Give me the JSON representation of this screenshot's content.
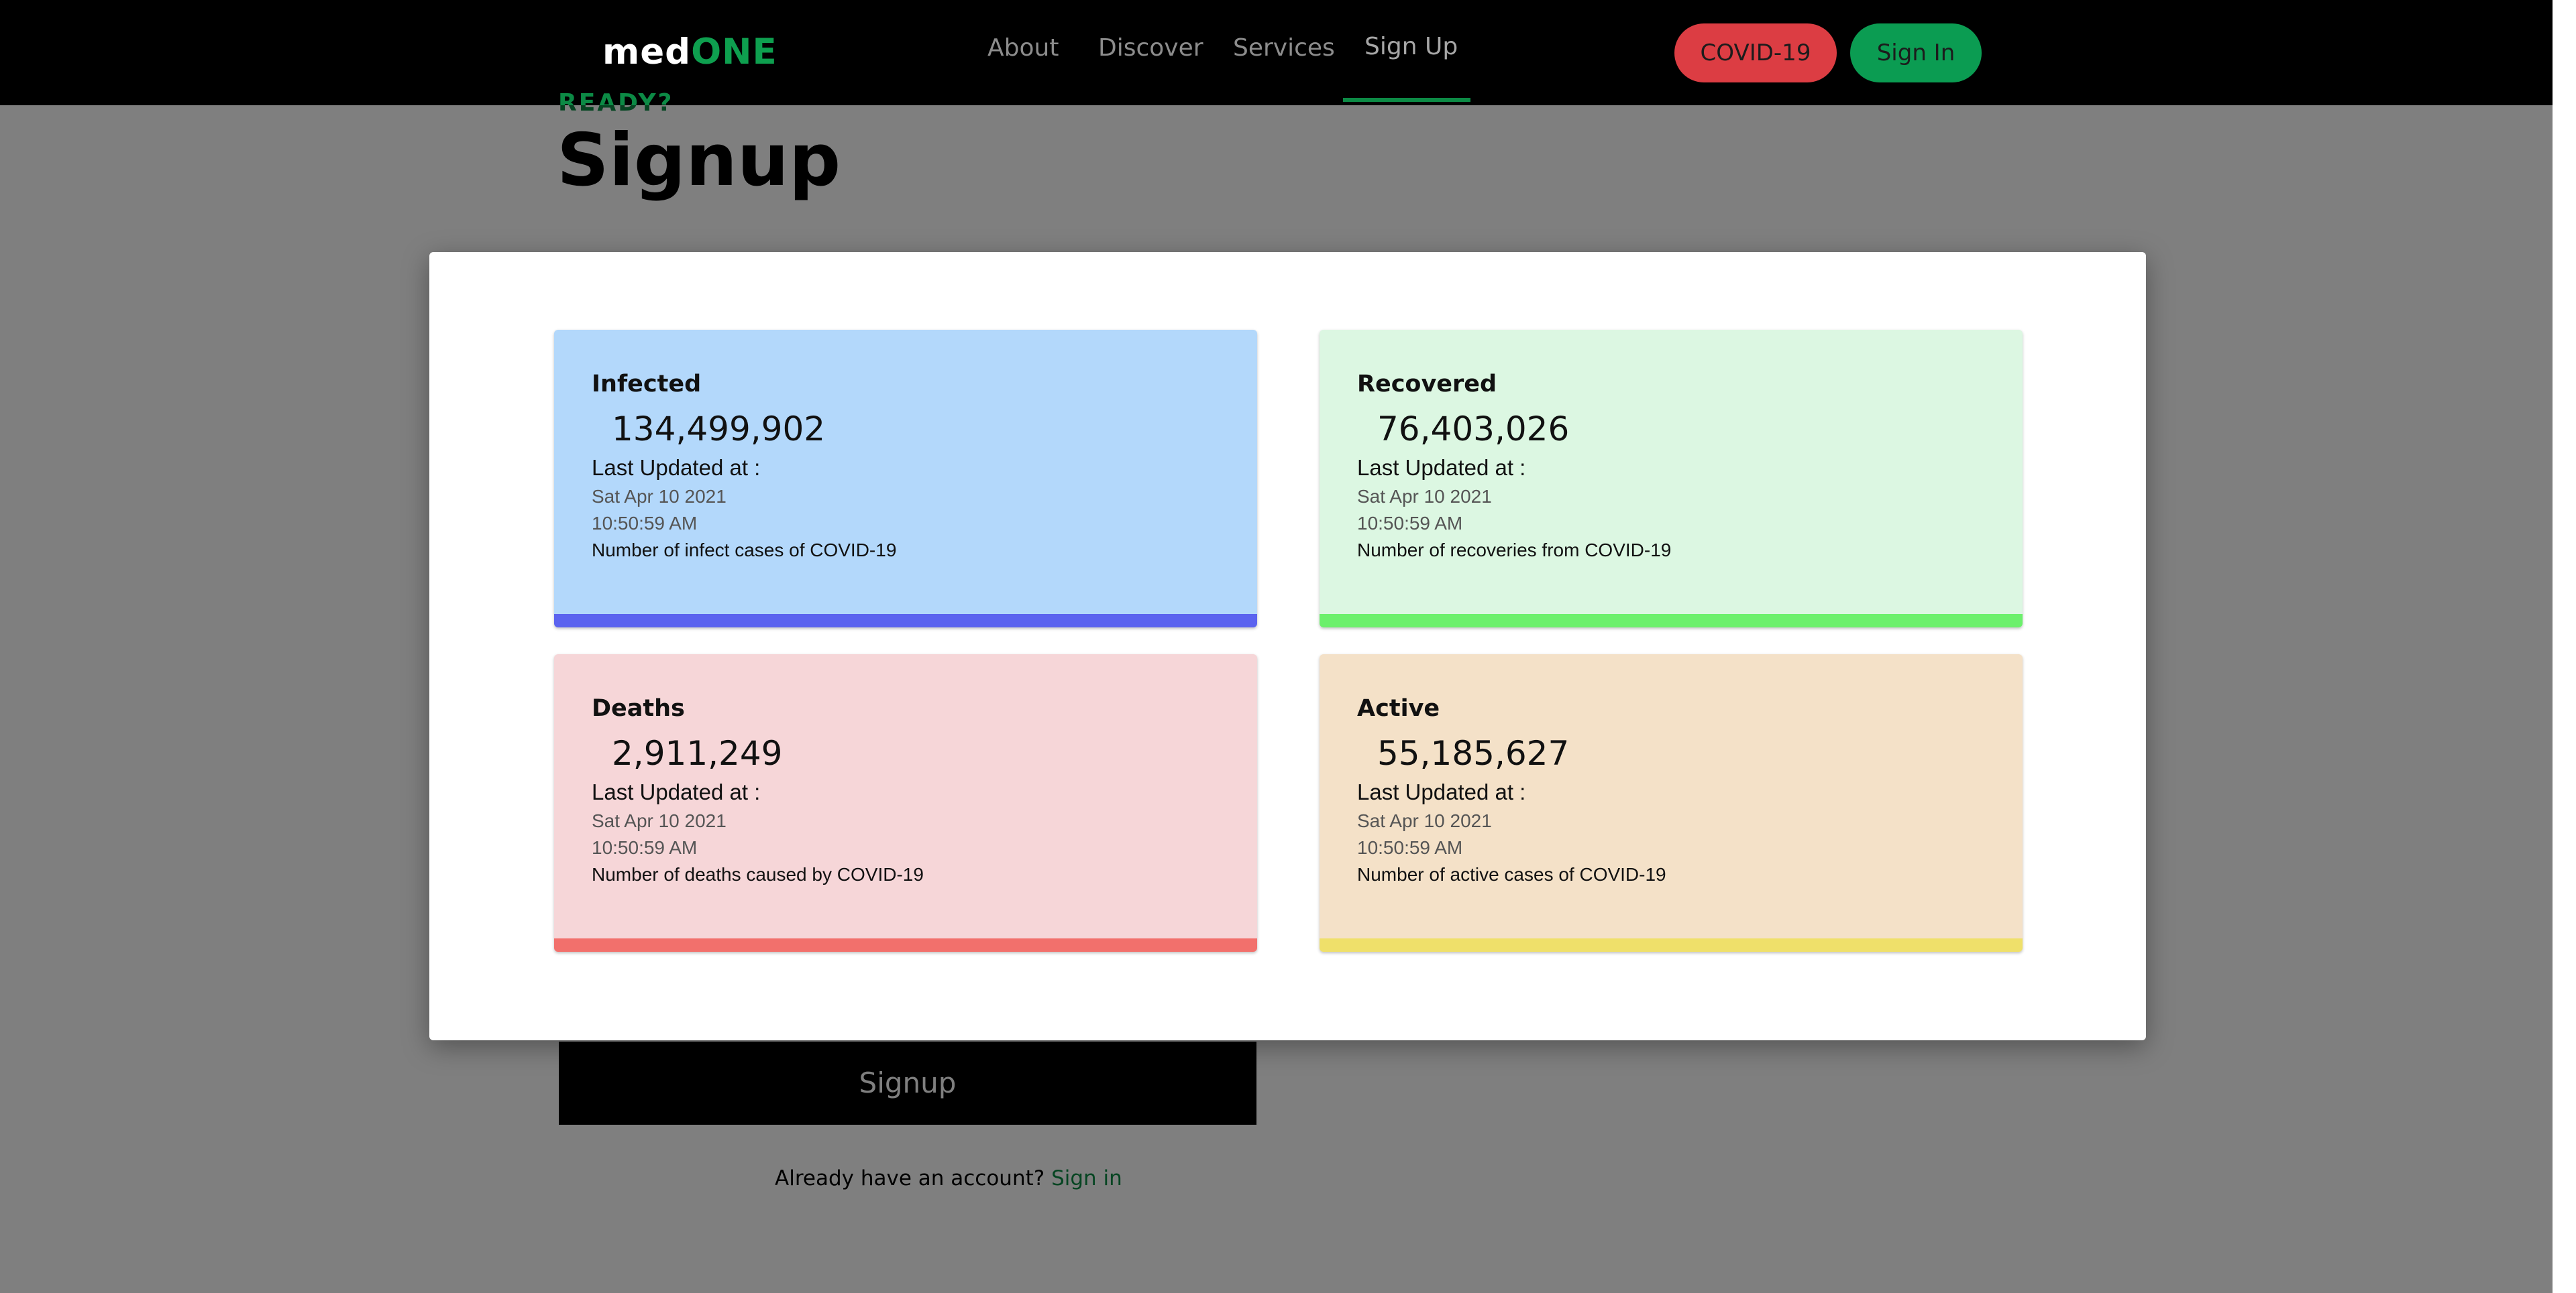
{
  "navbar": {
    "logo_part1": "med",
    "logo_part2": "ONE",
    "links": [
      "About",
      "Discover",
      "Services",
      "Sign Up"
    ],
    "covid_button": "COVID-19",
    "signin_button": "Sign In"
  },
  "page": {
    "ready_label": "READY?",
    "title": "Signup",
    "signup_button": "Signup",
    "already_text": "Already have an account?",
    "signin_link": "Sign in"
  },
  "modal": {
    "cards": [
      {
        "title": "Infected",
        "value": "134,499,902",
        "updated_label": "Last Updated at :",
        "date": "Sat Apr 10 2021",
        "time": "10:50:59 AM",
        "description": "Number of infect cases of COVID-19",
        "bg_color": "#b3d8fb",
        "bar_color": "#5b63ef"
      },
      {
        "title": "Recovered",
        "value": "76,403,026",
        "updated_label": "Last Updated at :",
        "date": "Sat Apr 10 2021",
        "time": "10:50:59 AM",
        "description": "Number of recoveries from COVID-19",
        "bg_color": "#dcf7e2",
        "bar_color": "#6cf06c"
      },
      {
        "title": "Deaths",
        "value": "2,911,249",
        "updated_label": "Last Updated at :",
        "date": "Sat Apr 10 2021",
        "time": "10:50:59 AM",
        "description": "Number of deaths caused by COVID-19",
        "bg_color": "#f6d6d8",
        "bar_color": "#f2706c"
      },
      {
        "title": "Active",
        "value": "55,185,627",
        "updated_label": "Last Updated at :",
        "date": "Sat Apr 10 2021",
        "time": "10:50:59 AM",
        "description": "Number of active cases of COVID-19",
        "bg_color": "#f4e1c8",
        "bar_color": "#efe06a"
      }
    ]
  },
  "colors": {
    "brand_green": "#0c8a45",
    "covid_red": "#dc3d43",
    "overlay": "rgba(0,0,0,0.5)"
  }
}
